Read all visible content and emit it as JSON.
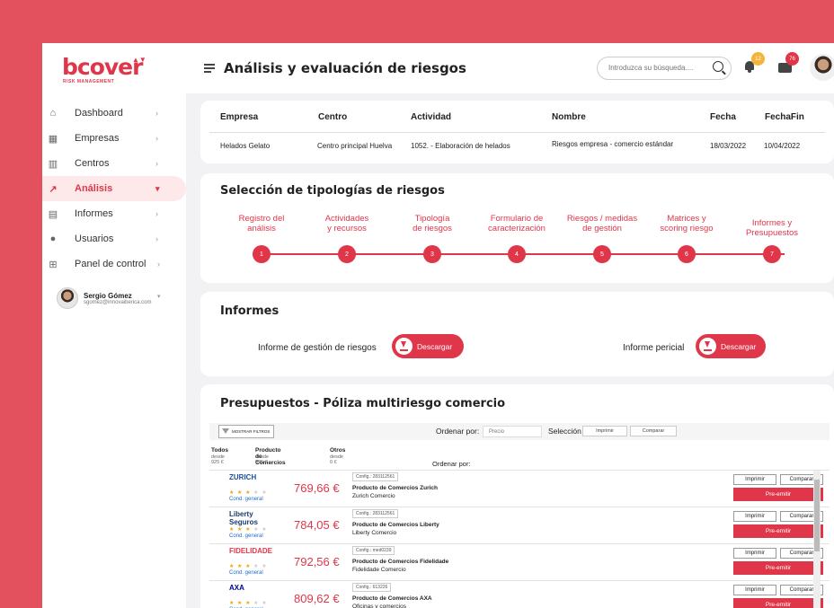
{
  "logo": {
    "text": "bcover",
    "sub": "RISK MANAGEMENT"
  },
  "sidebar": {
    "items": [
      {
        "label": "Dashboard",
        "icon": "home-icon",
        "active": false
      },
      {
        "label": "Empresas",
        "icon": "building-icon",
        "active": false
      },
      {
        "label": "Centros",
        "icon": "factory-icon",
        "active": false
      },
      {
        "label": "Análisis",
        "icon": "chart-icon",
        "active": true
      },
      {
        "label": "Informes",
        "icon": "document-icon",
        "active": false
      },
      {
        "label": "Usuarios",
        "icon": "users-icon",
        "active": false
      },
      {
        "label": "Panel de control",
        "icon": "grid-icon",
        "active": false
      }
    ],
    "user": {
      "name": "Sergio Gómez",
      "email": "sgomez@innovaiberica.com"
    }
  },
  "header": {
    "title": "Análisis y evaluación de riesgos",
    "search_placeholder": "Introduzca su búsqueda....",
    "bell_badge": "12",
    "mail_badge": "76"
  },
  "summary": {
    "headers": [
      "Empresa",
      "Centro",
      "Actividad",
      "Nombre",
      "Fecha",
      "FechaFin"
    ],
    "values": [
      "Helados Gelato",
      "Centro principal Huelva",
      "1052. - Elaboración de helados",
      "Riesgos empresa - comercio estándar",
      "18/03/2022",
      "10/04/2022"
    ]
  },
  "tipologias": {
    "title": "Selección de tipologías de riesgos",
    "steps": [
      {
        "label1": "Registro del",
        "label2": "análisis",
        "num": "1"
      },
      {
        "label1": "Actividades",
        "label2": "y recursos",
        "num": "2"
      },
      {
        "label1": "Tipología",
        "label2": "de riesgos",
        "num": "3"
      },
      {
        "label1": "Formulario de",
        "label2": "caracterización",
        "num": "4"
      },
      {
        "label1": "Riesgos / medidas",
        "label2": "de gestión",
        "num": "5"
      },
      {
        "label1": "Matrices y",
        "label2": "scoring riesgo",
        "num": "6"
      },
      {
        "label1": "Informes y",
        "label2": "Presupuestos",
        "num": "7"
      }
    ]
  },
  "informes": {
    "title": "Informes",
    "items": [
      {
        "label": "Informe de gestión de riesgos",
        "button": "Descargar"
      },
      {
        "label": "Informe pericial",
        "button": "Descargar"
      }
    ]
  },
  "presupuestos": {
    "title": "Presupuestos  - Póliza multiriesgo comercio",
    "filter_label": "MOSTRAR FILTROS",
    "order_label": "Ordenar por:",
    "order_value": "Precio",
    "selection_label": "Selección",
    "print_label": "Imprimir",
    "compare_label": "Comparar",
    "order_label2": "Ordenar por:",
    "tabs": [
      {
        "label": "Todos",
        "sub": "desde 925 €"
      },
      {
        "label": "Producto de Comercios",
        "sub": "desde 925 €"
      },
      {
        "label": "Otros",
        "sub": "desde 0 €"
      }
    ],
    "rows": [
      {
        "brand": "ZURICH",
        "brand_color": "#1c4f9c",
        "price": "769,66 €",
        "config": "Config.: 283112561",
        "product": "Producto de Comercios Zurich",
        "provider": "Zurich Comercio"
      },
      {
        "brand": "Liberty Seguros",
        "brand_color": "#1b3b6f",
        "price": "784,05 €",
        "config": "Config.: 283112561",
        "product": "Producto de Comercios Liberty",
        "provider": "Liberty Comercio"
      },
      {
        "brand": "FIDELIDADE",
        "brand_color": "#e0364a",
        "price": "792,56 €",
        "config": "Config.: med0239",
        "product": "Producto de Comercios Fidelidade",
        "provider": "Fidelidade Comercio"
      },
      {
        "brand": "AXA",
        "brand_color": "#00008f",
        "price": "809,62 €",
        "config": "Config.: 613226",
        "product": "Producto de Comercios AXA",
        "provider": "Oficinas y comercios"
      }
    ],
    "row_print": "Imprimir",
    "row_compare": "Comparar",
    "row_issue": "Pre-emitir",
    "cond_label": "Cond. general"
  }
}
